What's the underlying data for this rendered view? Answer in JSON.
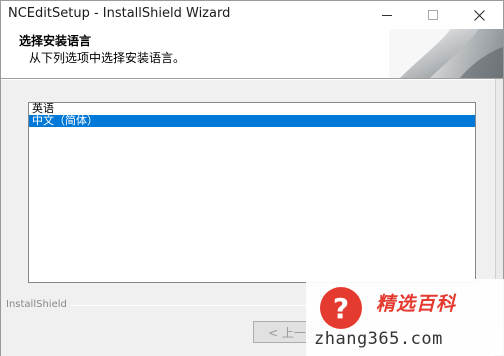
{
  "window": {
    "title": "NCEditSetup - InstallShield Wizard"
  },
  "header": {
    "title": "选择安装语言",
    "subtitle": "从下列选项中选择安装语言。"
  },
  "languages": [
    {
      "label": "英语",
      "selected": false
    },
    {
      "label": "中文（简体）",
      "selected": true
    }
  ],
  "footer": {
    "brand": "InstallShield",
    "back_label": "< 上一步"
  },
  "watermark": {
    "title": "精选百科",
    "url": "zhang365.com"
  },
  "colors": {
    "selection": "#0078d7",
    "watermark_red": "#e53a2f"
  }
}
